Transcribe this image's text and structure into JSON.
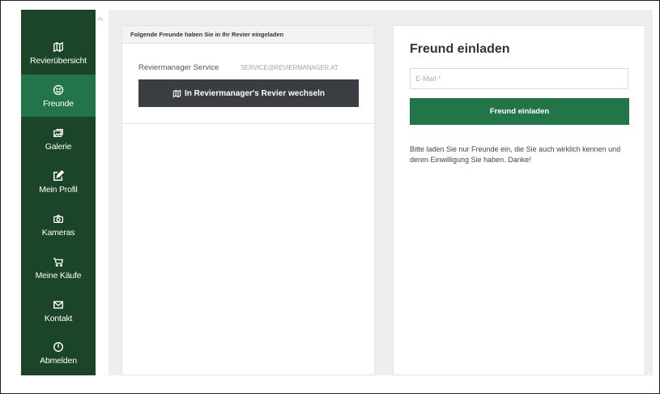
{
  "sidebar": {
    "items": [
      {
        "label": "Revierübersicht",
        "icon": "map-icon",
        "active": false
      },
      {
        "label": "Freunde",
        "icon": "smiley-icon",
        "active": true
      },
      {
        "label": "Galerie",
        "icon": "gallery-icon",
        "active": false
      },
      {
        "label": "Mein Profil",
        "icon": "edit-icon",
        "active": false
      },
      {
        "label": "Kameras",
        "icon": "camera-icon",
        "active": false
      },
      {
        "label": "Meine Käufe",
        "icon": "cart-icon",
        "active": false
      },
      {
        "label": "Kontakt",
        "icon": "envelope-icon",
        "active": false
      },
      {
        "label": "Abmelden",
        "icon": "power-icon",
        "active": false
      }
    ]
  },
  "friends_panel": {
    "header": "Folgende Freunde haben Sie in Ihr Revier eingeladen",
    "friend_name": "Reviermanager Service",
    "friend_email": "SERVICE@REVIERMANAGER.AT",
    "switch_button": "In Reviermanager's Revier wechseln"
  },
  "invite_panel": {
    "title": "Freund einladen",
    "email_placeholder": "E-Mail *",
    "button": "Freund einladen",
    "note": "Bitte laden Sie nur Freunde ein, die Sie auch wirklich kennen und deren Einwilligung Sie haben. Danke!"
  },
  "colors": {
    "sidebar": "#1b4429",
    "active": "#24744a",
    "dark_button": "#3a3d42"
  }
}
